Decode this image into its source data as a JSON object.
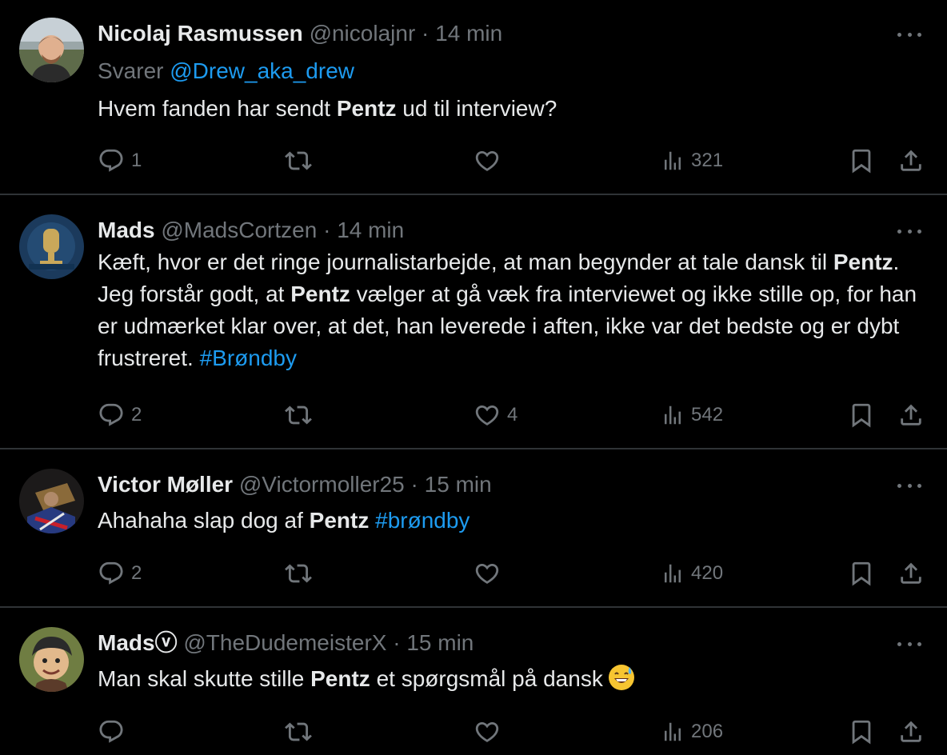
{
  "tweets": [
    {
      "name": "Nicolaj Rasmussen",
      "handle": "@nicolajnr",
      "sep": "·",
      "time": "14 min",
      "reply_prefix": "Svarer ",
      "reply_to": "@Drew_aka_drew",
      "text": [
        {
          "t": "Hvem fanden har sendt "
        },
        {
          "t": "Pentz",
          "b": true
        },
        {
          "t": " ud til interview?"
        }
      ],
      "replies": "1",
      "retweets": "",
      "likes": "",
      "views": "321"
    },
    {
      "name": "Mads",
      "handle": "@MadsCortzen",
      "sep": "·",
      "time": "14 min",
      "text": [
        {
          "t": "Kæft, hvor er det ringe journalistarbejde, at man begynder at tale dansk til "
        },
        {
          "t": "Pentz",
          "b": true
        },
        {
          "t": ". Jeg forstår godt, at "
        },
        {
          "t": "Pentz",
          "b": true
        },
        {
          "t": " vælger at gå væk fra interviewet og ikke stille op, for han er udmærket klar over, at det, han leverede i aften, ikke var det bedste og er dybt frustreret. "
        },
        {
          "t": "#Brøndby",
          "l": true
        }
      ],
      "replies": "2",
      "retweets": "",
      "likes": "4",
      "views": "542"
    },
    {
      "name": "Victor Møller",
      "handle": "@Victormoller25",
      "sep": "·",
      "time": "15 min",
      "text": [
        {
          "t": "Ahahaha slap dog af "
        },
        {
          "t": "Pentz",
          "b": true
        },
        {
          "t": " "
        },
        {
          "t": "#brøndby",
          "l": true
        }
      ],
      "replies": "2",
      "retweets": "",
      "likes": "",
      "views": "420"
    },
    {
      "name": "Madsⓥ",
      "handle": "@TheDudemeisterX",
      "sep": "·",
      "time": "15 min",
      "text": [
        {
          "t": "Man skal skutte stille "
        },
        {
          "t": "Pentz",
          "b": true
        },
        {
          "t": " et spørgsmål på dansk"
        }
      ],
      "emoji": "sweat-smile-emoji",
      "replies": "",
      "retweets": "",
      "likes": "",
      "views": "206"
    }
  ],
  "icons": {
    "reply": "reply-icon",
    "retweet": "retweet-icon",
    "like": "heart-icon",
    "views": "views-icon",
    "bookmark": "bookmark-icon",
    "share": "share-icon",
    "more": "more-icon"
  },
  "colors": {
    "background": "#000000",
    "text": "#e7e9ea",
    "muted": "#71767b",
    "link": "#1d9bf0",
    "divider": "#2f3336"
  }
}
